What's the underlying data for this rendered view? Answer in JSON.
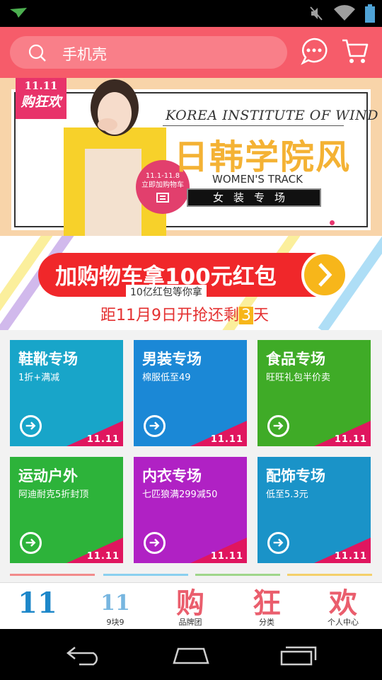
{
  "colors": {
    "accent": "#f65c6a",
    "red": "#f0272a",
    "gold": "#f7b61a",
    "pink": "#e0165f"
  },
  "search": {
    "placeholder": "手机壳"
  },
  "banner": {
    "badge_top": "11.11",
    "badge_bottom": "购狂欢",
    "circle_tag_line1": "11.1-11.8",
    "circle_tag_line2": "立即加购物车",
    "title_en": "KOREA INSTITUTE OF WIND",
    "title_cn": "日韩学院风",
    "subtitle_en": "WOMEN'S TRACK",
    "box_text": "女装专场",
    "dots": 8,
    "active_dot": 4
  },
  "promo": {
    "main": "加购物车拿100元红包",
    "sub": "10亿红包等你拿",
    "countdown_prefix": "距11月9日开抢还剩",
    "countdown_num": "3",
    "countdown_suffix": "天"
  },
  "tiles": [
    {
      "title": "鞋靴专场",
      "sub": "1折+满减",
      "badge": "11.11",
      "bg": "#18a5c9"
    },
    {
      "title": "男装专场",
      "sub": "棉服低至49",
      "badge": "11.11",
      "bg": "#1b88d6"
    },
    {
      "title": "食品专场",
      "sub": "旺旺礼包半价卖",
      "badge": "11.11",
      "bg": "#3fab27"
    },
    {
      "title": "运动户外",
      "sub": "阿迪耐克5折封顶",
      "badge": "11.11",
      "bg": "#2db33a"
    },
    {
      "title": "内衣专场",
      "sub": "七匹狼满299减50",
      "badge": "11.11",
      "bg": "#b021c4"
    },
    {
      "title": "配饰专场",
      "sub": "低至5.3元",
      "badge": "11.11",
      "bg": "#1a93c8"
    }
  ],
  "bottom_nav": {
    "home_glyph": "11",
    "items": [
      {
        "glyph": "11",
        "label": "9块9"
      },
      {
        "glyph": "购",
        "label": "品牌团"
      },
      {
        "glyph": "狂",
        "label": "分类"
      },
      {
        "glyph": "欢",
        "label": "个人中心"
      }
    ]
  }
}
